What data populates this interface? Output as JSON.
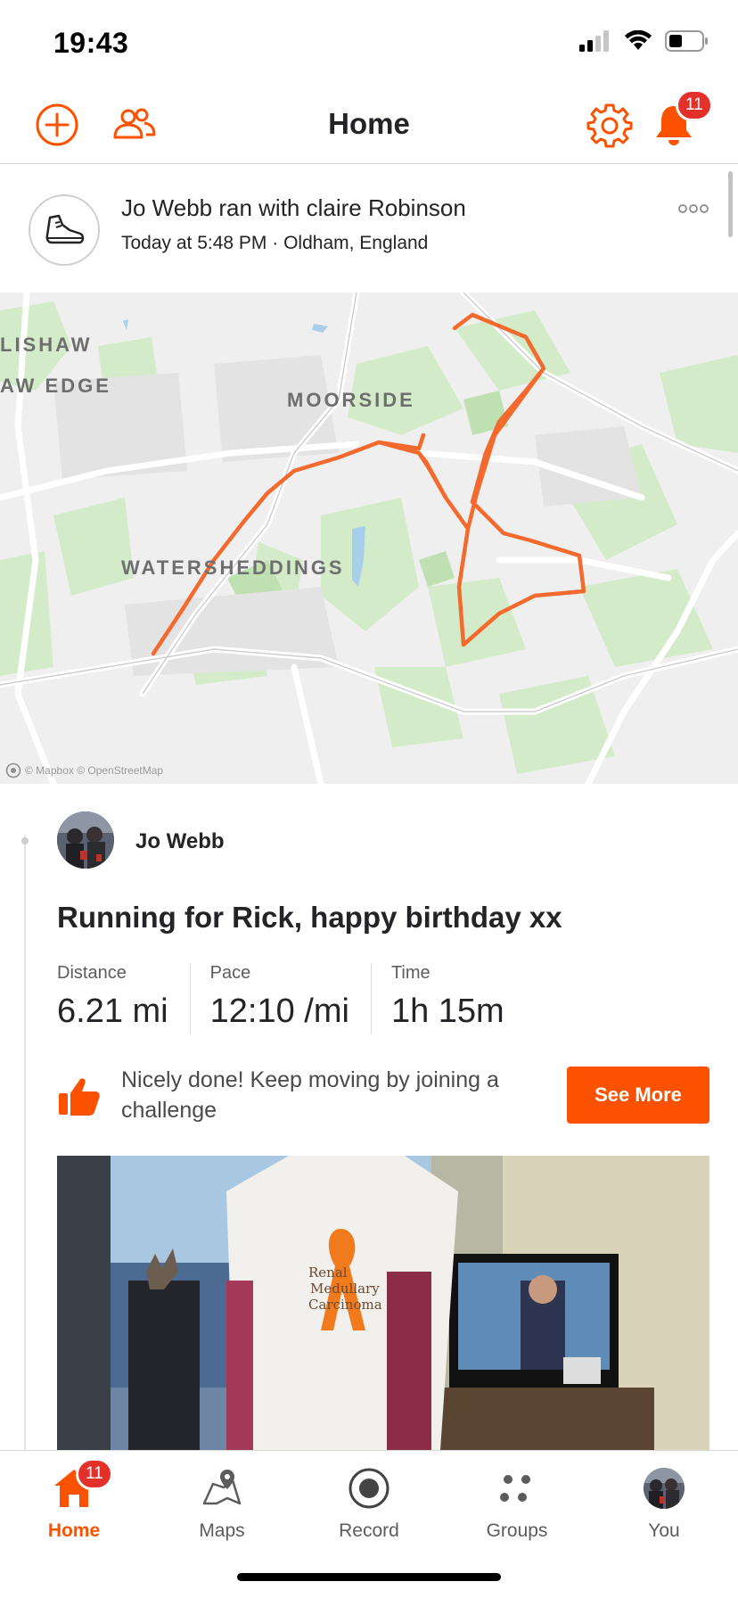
{
  "status_bar": {
    "time": "19:43"
  },
  "header": {
    "title": "Home",
    "notification_count": "11",
    "icons": [
      "add-icon",
      "people-icon",
      "settings-icon",
      "bell-icon"
    ]
  },
  "activity": {
    "title": "Jo Webb ran with claire Robinson",
    "meta": "Today at 5:48 PM · Oldham, England",
    "sport_icon": "running-shoe-icon",
    "map": {
      "labels": [
        "LISHAW",
        "AW EDGE",
        "MOORSIDE",
        "WATERSHEDDINGS"
      ],
      "credit": "© Mapbox © OpenStreetMap",
      "route_color": "#f26a2e"
    },
    "athlete_name": "Jo Webb",
    "name": "Running for Rick, happy birthday xx",
    "stats": [
      {
        "label": "Distance",
        "value": "6.21 mi"
      },
      {
        "label": "Pace",
        "value": "12:10 /mi"
      },
      {
        "label": "Time",
        "value": "1h 15m"
      }
    ],
    "achievement_text": "Nicely done! Keep moving by joining a challenge",
    "see_more_label": "See More"
  },
  "tab_bar": {
    "home_badge": "11",
    "tabs": [
      {
        "label": "Home",
        "icon": "home-icon",
        "active": true
      },
      {
        "label": "Maps",
        "icon": "maps-icon",
        "active": false
      },
      {
        "label": "Record",
        "icon": "record-icon",
        "active": false
      },
      {
        "label": "Groups",
        "icon": "groups-icon",
        "active": false
      },
      {
        "label": "You",
        "icon": "profile-avatar",
        "active": false
      }
    ]
  },
  "colors": {
    "accent": "#fc5200",
    "badge": "#e4302a",
    "text": "#242428"
  }
}
